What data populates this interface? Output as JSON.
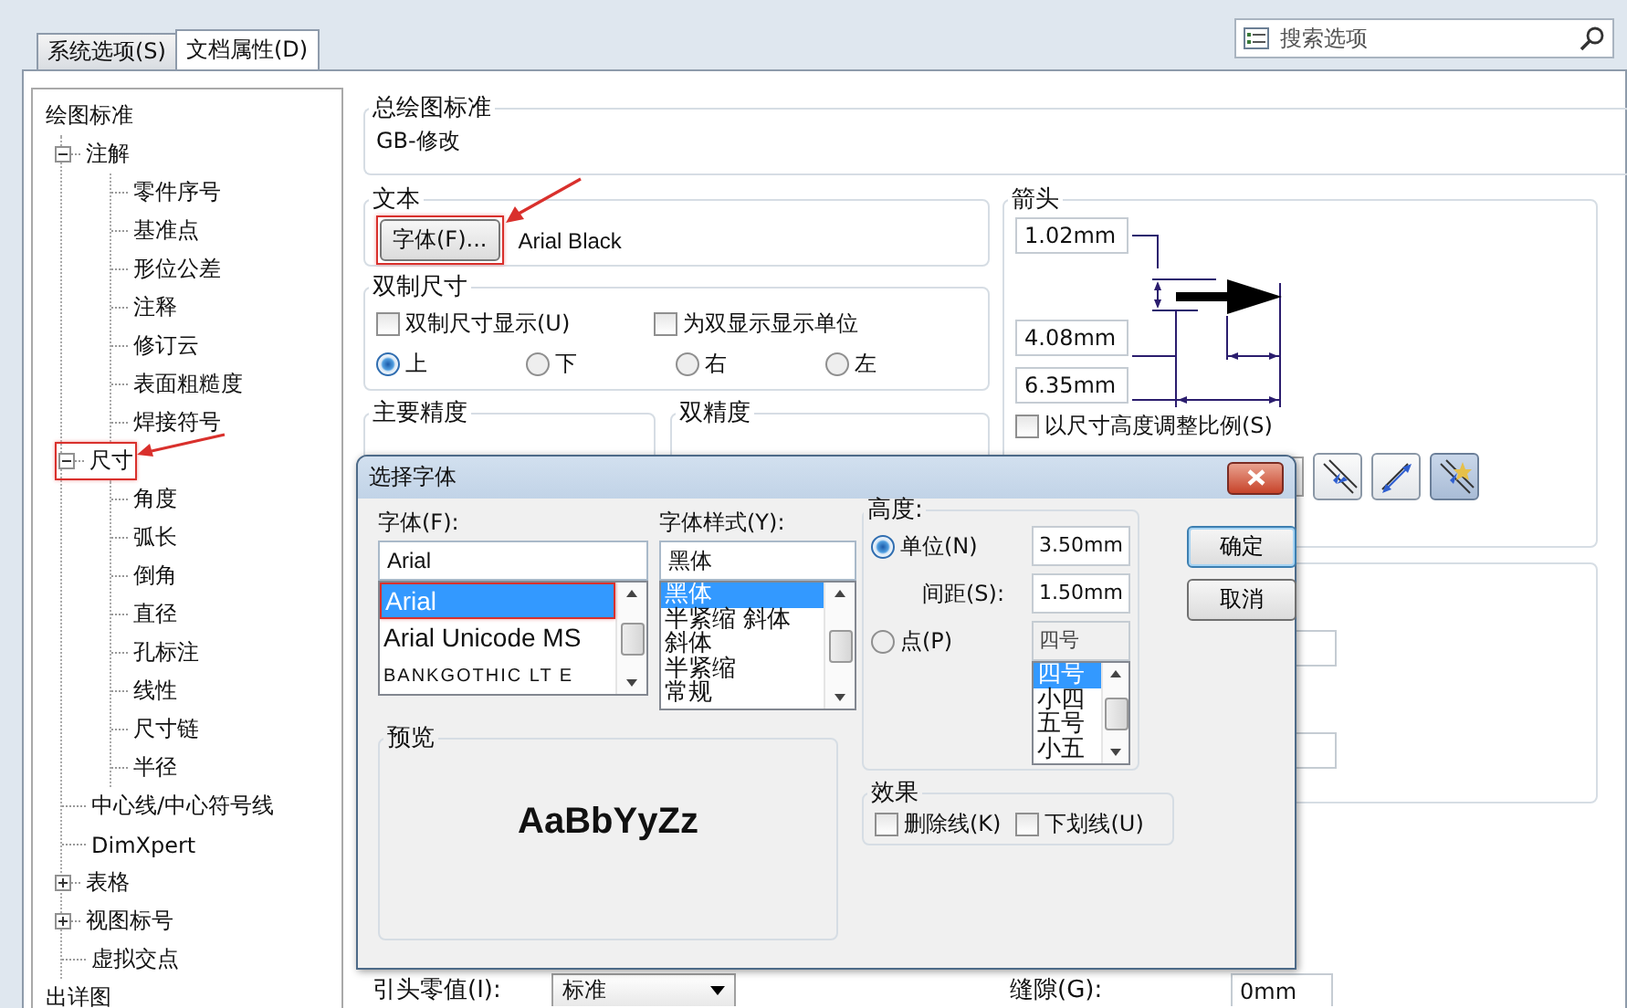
{
  "tabs": [
    {
      "label": "系统选项(S)",
      "selected": false
    },
    {
      "label": "文档属性(D)",
      "selected": true
    }
  ],
  "search": {
    "placeholder": "搜索选项"
  },
  "tree": [
    {
      "label": "绘图标准",
      "children": [
        {
          "label": "注解",
          "expanded": true,
          "children": [
            {
              "label": "零件序号"
            },
            {
              "label": "基准点"
            },
            {
              "label": "形位公差"
            },
            {
              "label": "注释"
            },
            {
              "label": "修订云"
            },
            {
              "label": "表面粗糙度"
            },
            {
              "label": "焊接符号"
            }
          ]
        },
        {
          "label": "尺寸",
          "expanded": true,
          "highlighted": true,
          "children": [
            {
              "label": "角度"
            },
            {
              "label": "弧长"
            },
            {
              "label": "倒角"
            },
            {
              "label": "直径"
            },
            {
              "label": "孔标注"
            },
            {
              "label": "线性"
            },
            {
              "label": "尺寸链"
            },
            {
              "label": "半径"
            }
          ]
        },
        {
          "label": "中心线/中心符号线"
        },
        {
          "label": "DimXpert"
        },
        {
          "label": "表格",
          "expanded": false
        },
        {
          "label": "视图标号",
          "expanded": false
        },
        {
          "label": "虚拟交点"
        }
      ]
    },
    {
      "label": "出详图"
    }
  ],
  "drafting_standard": {
    "title": "总绘图标准",
    "value": "GB-修改"
  },
  "text_group": {
    "title": "文本",
    "font_button": {
      "label": "字体(F)...",
      "highlighted": true
    },
    "font_name": "Arial Black"
  },
  "dual_dimensions": {
    "title": "双制尺寸",
    "checkboxes": [
      {
        "label": "双制尺寸显示(U)",
        "checked": false
      },
      {
        "label": "为双显示显示单位",
        "checked": false
      }
    ],
    "positions": [
      {
        "label": "上",
        "selected": true
      },
      {
        "label": "下",
        "selected": false
      },
      {
        "label": "右",
        "selected": false
      },
      {
        "label": "左",
        "selected": false
      }
    ]
  },
  "precision_groups": [
    {
      "title": "主要精度"
    },
    {
      "title": "双精度"
    }
  ],
  "arrows": {
    "title": "箭头",
    "fields": [
      "1.02mm",
      "4.08mm",
      "6.35mm"
    ],
    "scale_checkbox": {
      "label": "以尺寸高度调整比例(S)",
      "checked": false
    },
    "style_buttons": [
      {
        "selected": false
      },
      {
        "selected": false
      },
      {
        "selected": true
      }
    ]
  },
  "leading_zeros": {
    "label": "引头零值(I):",
    "value": "标准"
  },
  "gap": {
    "label": "缝隙(G):",
    "value": "0mm"
  },
  "font_dialog": {
    "title": "选择字体",
    "font": {
      "label": "字体(F):",
      "value": "Arial",
      "options": [
        {
          "label": "Arial",
          "selected": true,
          "highlighted": true
        },
        {
          "label": "Arial Unicode MS",
          "selected": false
        },
        {
          "label": "BANKGOTHIC LT E",
          "selected": false
        }
      ]
    },
    "style": {
      "label": "字体样式(Y):",
      "value": "黑体",
      "options": [
        {
          "label": "黑体",
          "selected": true
        },
        {
          "label": "半紧缩 斜体",
          "selected": false
        },
        {
          "label": "斜体",
          "selected": false
        },
        {
          "label": "半紧缩",
          "selected": false
        },
        {
          "label": "常规",
          "selected": false
        }
      ]
    },
    "height": {
      "title": "高度:",
      "modes": [
        {
          "label": "单位(N)",
          "selected": true,
          "value": "3.50mm"
        },
        {
          "label": "点(P)",
          "selected": false,
          "value": "四号"
        }
      ],
      "spacing": {
        "label": "间距(S):",
        "value": "1.50mm"
      },
      "sizes": [
        {
          "label": "四号",
          "selected": true
        },
        {
          "label": "小四",
          "selected": false
        },
        {
          "label": "五号",
          "selected": false
        },
        {
          "label": "小五",
          "selected": false
        }
      ]
    },
    "buttons": [
      "确定",
      "取消"
    ],
    "preview": {
      "title": "预览",
      "sample": "AaBbYyZz"
    },
    "effects": {
      "title": "效果",
      "options": [
        {
          "label": "删除线(K)",
          "checked": false
        },
        {
          "label": "下划线(U)",
          "checked": false
        }
      ]
    }
  }
}
